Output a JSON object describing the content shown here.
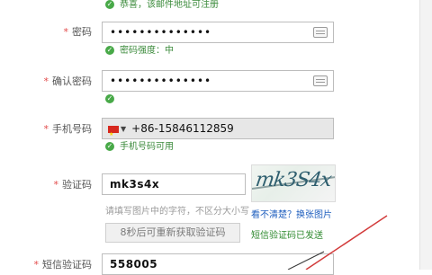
{
  "top_hint": {
    "text": "恭喜，该邮件地址可注册"
  },
  "password": {
    "label": "密码",
    "masked": "••••••••••••••",
    "strength": "密码强度：中"
  },
  "confirm_password": {
    "label": "确认密码",
    "masked": "••••••••••••••"
  },
  "phone": {
    "label": "手机号码",
    "country_code": "+86",
    "number": "-15846112859",
    "status": "手机号码可用"
  },
  "captcha": {
    "label": "验证码",
    "value": "mk3s4x",
    "image_text": "mk3S4x",
    "help": "请填写图片中的字符，不区分大小写",
    "refresh_link": "看不清楚？换张图片"
  },
  "sms": {
    "resend_button": "8秒后可重新获取验证码",
    "sent_text": "短信验证码已发送",
    "label": "短信验证码",
    "value": "558005"
  },
  "required_mark": "*"
}
